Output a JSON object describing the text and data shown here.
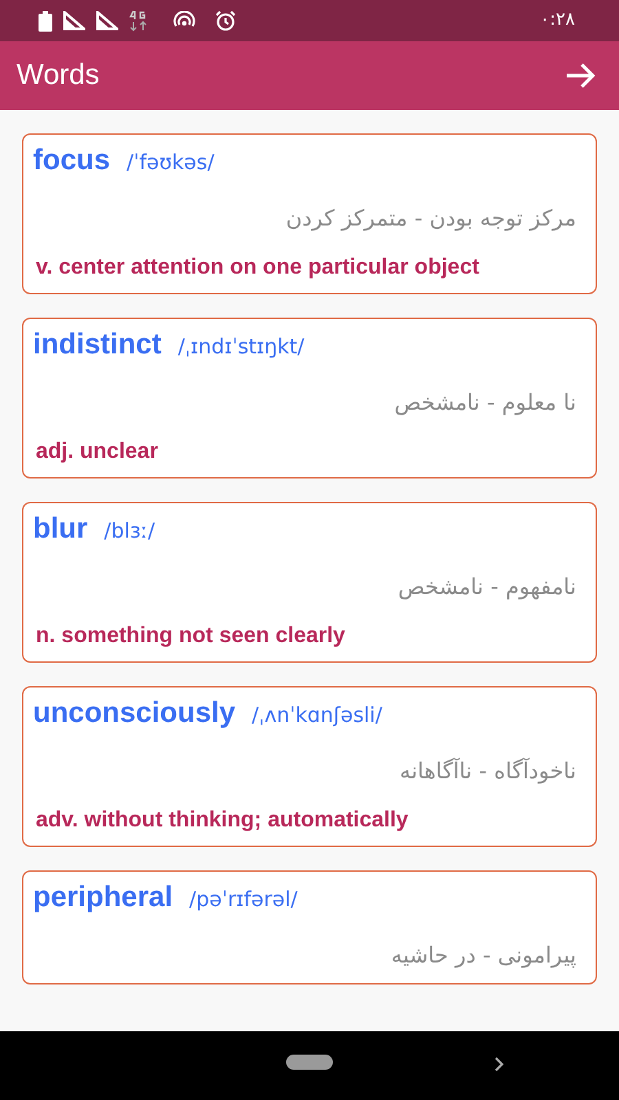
{
  "status_bar": {
    "time": "۰:۲۸"
  },
  "app_bar": {
    "title": "Words"
  },
  "words": [
    {
      "word": "focus",
      "pronunciation": "/ˈfəʊkəs/",
      "translation": "مرکز توجه بودن - متمرکز کردن",
      "definition": "v. center attention on one particular object"
    },
    {
      "word": "indistinct",
      "pronunciation": "/ˌɪndɪˈstɪŋkt/",
      "translation": "نا معلوم - نامشخص",
      "definition": "adj. unclear"
    },
    {
      "word": "blur",
      "pronunciation": "/blɜː/",
      "translation": "نامفهوم - نامشخص",
      "definition": "n. something not seen clearly"
    },
    {
      "word": "unconsciously",
      "pronunciation": "/ˌʌnˈkɑnʃəsli/",
      "translation": "ناخودآگاه - ناآگاهانه",
      "definition": "adv. without thinking; automatically"
    },
    {
      "word": "peripheral",
      "pronunciation": "/pəˈrɪfərəl/",
      "translation": "پیرامونی - در حاشیه"
    }
  ]
}
